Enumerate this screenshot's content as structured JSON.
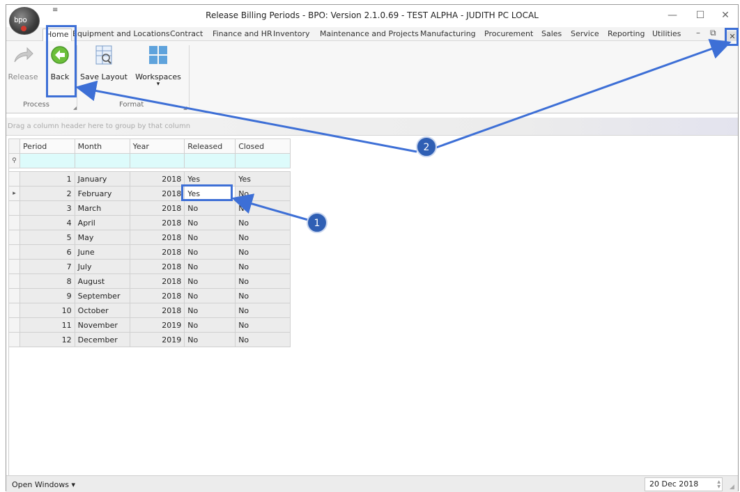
{
  "window": {
    "title": "Release Billing Periods - BPO: Version 2.1.0.69 - TEST ALPHA - JUDITH PC LOCAL",
    "logo_text": "bpo",
    "qat_glyph": "≡",
    "minimize": "—",
    "maximize": "☐",
    "close": "✕"
  },
  "menu": {
    "tabs": [
      "Home",
      "Equipment and Locations",
      "Contract",
      "Finance and HR",
      "Inventory",
      "Maintenance and Projects",
      "Manufacturing",
      "Procurement",
      "Sales",
      "Service",
      "Reporting",
      "Utilities"
    ],
    "mdi_minimize": "–",
    "mdi_restore": "⧉",
    "mdi_close": "✕"
  },
  "ribbon": {
    "release_label": "Release",
    "back_label": "Back",
    "save_layout_label": "Save Layout",
    "workspaces_label": "Workspaces",
    "workspaces_dropdown": "▾",
    "group_process": "Process",
    "group_format": "Format",
    "launcher": "◢"
  },
  "grid": {
    "group_hint": "Drag a column header here to group by that column",
    "filter_glyph": "⚲",
    "row_pointer": "▸",
    "columns": [
      "Period",
      "Month",
      "Year",
      "Released",
      "Closed"
    ],
    "rows": [
      {
        "period": "1",
        "month": "January",
        "year": "2018",
        "released": "Yes",
        "closed": "Yes"
      },
      {
        "period": "2",
        "month": "February",
        "year": "2018",
        "released": "Yes",
        "closed": "No"
      },
      {
        "period": "3",
        "month": "March",
        "year": "2018",
        "released": "No",
        "closed": "No"
      },
      {
        "period": "4",
        "month": "April",
        "year": "2018",
        "released": "No",
        "closed": "No"
      },
      {
        "period": "5",
        "month": "May",
        "year": "2018",
        "released": "No",
        "closed": "No"
      },
      {
        "period": "6",
        "month": "June",
        "year": "2018",
        "released": "No",
        "closed": "No"
      },
      {
        "period": "7",
        "month": "July",
        "year": "2018",
        "released": "No",
        "closed": "No"
      },
      {
        "period": "8",
        "month": "August",
        "year": "2018",
        "released": "No",
        "closed": "No"
      },
      {
        "period": "9",
        "month": "September",
        "year": "2018",
        "released": "No",
        "closed": "No"
      },
      {
        "period": "10",
        "month": "October",
        "year": "2018",
        "released": "No",
        "closed": "No"
      },
      {
        "period": "11",
        "month": "November",
        "year": "2019",
        "released": "No",
        "closed": "No"
      },
      {
        "period": "12",
        "month": "December",
        "year": "2019",
        "released": "No",
        "closed": "No"
      }
    ]
  },
  "status": {
    "open_windows": "Open Windows ▾",
    "date": "20 Dec 2018",
    "spin_up": "▲",
    "spin_down": "▼",
    "grip": "◢"
  },
  "callouts": {
    "one": "1",
    "two": "2",
    "color": "#3d6fd6",
    "fill": "#2f5fb4"
  }
}
